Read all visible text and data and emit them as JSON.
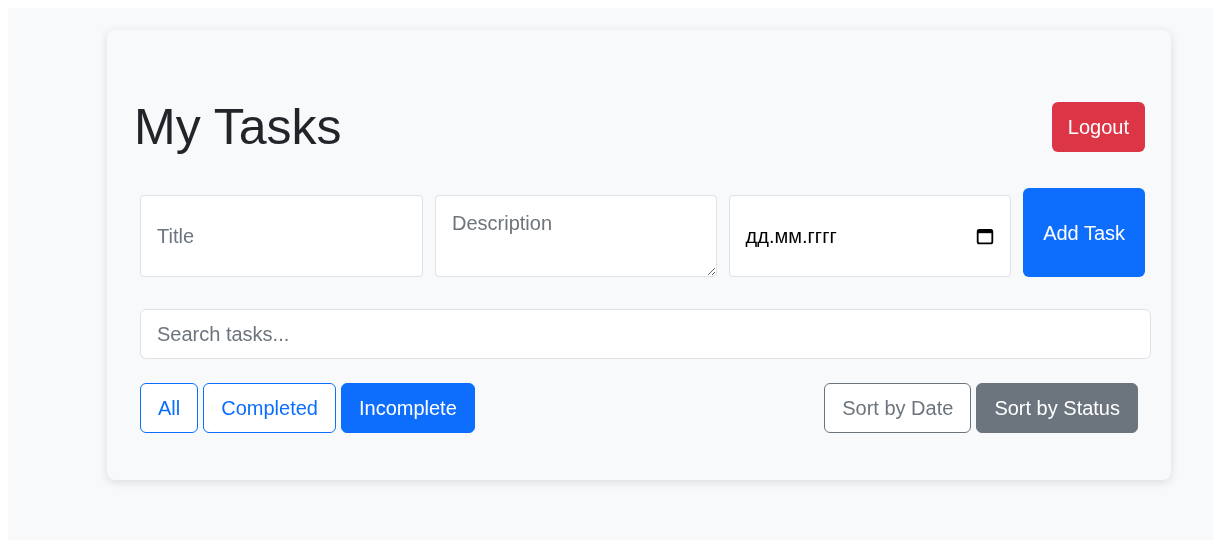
{
  "header": {
    "title": "My Tasks",
    "logout": "Logout"
  },
  "form": {
    "title": {
      "placeholder": "Title"
    },
    "description": {
      "placeholder": "Description"
    },
    "date": {
      "placeholder": "дд.мм.гггг"
    },
    "submit": "Add Task"
  },
  "search": {
    "placeholder": "Search tasks..."
  },
  "filters": [
    {
      "label": "All",
      "selected": false
    },
    {
      "label": "Completed",
      "selected": false
    },
    {
      "label": "Incomplete",
      "selected": true
    }
  ],
  "sorts": [
    {
      "label": "Sort by Date",
      "selected": false
    },
    {
      "label": "Sort by Status",
      "selected": true
    }
  ]
}
